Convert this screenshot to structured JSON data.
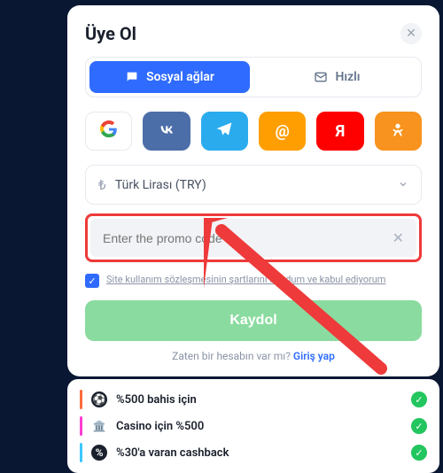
{
  "modal": {
    "title": "Üye Ol",
    "tabs": {
      "social": "Sosyal ağlar",
      "quick": "Hızlı"
    },
    "currency": {
      "symbol": "₺",
      "label": "Türk Lirası (TRY)"
    },
    "promo": {
      "placeholder": "Enter the promo code"
    },
    "terms": "Site kullanım sözleşmesinin şartlarını okudum ve kabul ediyorum",
    "submit": "Kaydol",
    "login_prompt": "Zaten bir hesabın var mı?",
    "login_link": "Giriş yap"
  },
  "social": {
    "google": "G",
    "vk": "VK",
    "mailru": "@",
    "yandex": "Я",
    "ok": "ok"
  },
  "bonuses": [
    {
      "label": "%500 bahis için"
    },
    {
      "label": "Casino için %500"
    },
    {
      "label": "%30'a varan cashback"
    }
  ]
}
